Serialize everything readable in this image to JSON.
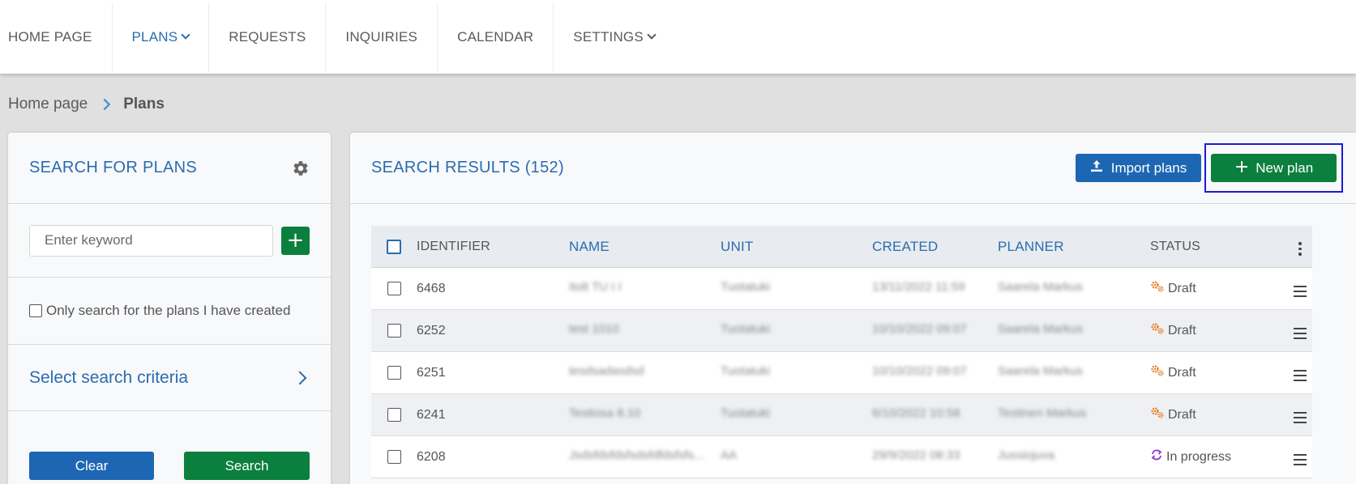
{
  "nav": {
    "items": [
      {
        "label": "HOME PAGE"
      },
      {
        "label": "PLANS"
      },
      {
        "label": "REQUESTS"
      },
      {
        "label": "INQUIRIES"
      },
      {
        "label": "CALENDAR"
      },
      {
        "label": "SETTINGS"
      }
    ],
    "active": "PLANS",
    "active_color": "#2a6cb0"
  },
  "breadcrumb": {
    "home": "Home page",
    "current": "Plans"
  },
  "search_panel": {
    "title": "SEARCH FOR PLANS",
    "keyword_placeholder": "Enter keyword",
    "keyword_value": "",
    "add_label": "+",
    "only_mine_label": "Only search for the plans I have created",
    "only_mine_checked": false,
    "criteria_label": "Select search criteria",
    "clear_label": "Clear",
    "search_label": "Search"
  },
  "results": {
    "title": "SEARCH RESULTS (152)",
    "import_label": "Import plans",
    "new_label": "New plan",
    "columns": [
      "IDENTIFIER",
      "NAME",
      "UNIT",
      "CREATED",
      "PLANNER",
      "STATUS"
    ],
    "rows": [
      {
        "id": "6468",
        "name": "Itolt TU I I",
        "unit": "Tuotatuki",
        "created": "13/11/2022 11:59",
        "planner": "Saarela Markus",
        "status": "Draft",
        "status_icon": "gears-icon"
      },
      {
        "id": "6252",
        "name": "test 1010",
        "unit": "Tuotatuki",
        "created": "10/10/2022 09:07",
        "planner": "Saarela Markus",
        "status": "Draft",
        "status_icon": "gears-icon"
      },
      {
        "id": "6251",
        "name": "tesdsadasdsd",
        "unit": "Tuotatuki",
        "created": "10/10/2022 09:07",
        "planner": "Saarela Markus",
        "status": "Draft",
        "status_icon": "gears-icon"
      },
      {
        "id": "6241",
        "name": "Testiosa 8.10",
        "unit": "Tuotatuki",
        "created": "6/10/2022 10:58",
        "planner": "Testinen Markus",
        "status": "Draft",
        "status_icon": "gears-icon"
      },
      {
        "id": "6208",
        "name": "Jsdsfdsfdsfsdsfdfdsfsfs...",
        "unit": "AA",
        "created": "29/9/2022 08:33",
        "planner": "Jussiojuva",
        "status": "In progress",
        "status_icon": "sync-icon"
      }
    ]
  },
  "colors": {
    "primary_blue": "#1d66b3",
    "green": "#0b7f3e",
    "draft_orange": "#e8822a",
    "in_progress_purple": "#8a3fd1",
    "highlight_border": "#1a1ad8"
  }
}
